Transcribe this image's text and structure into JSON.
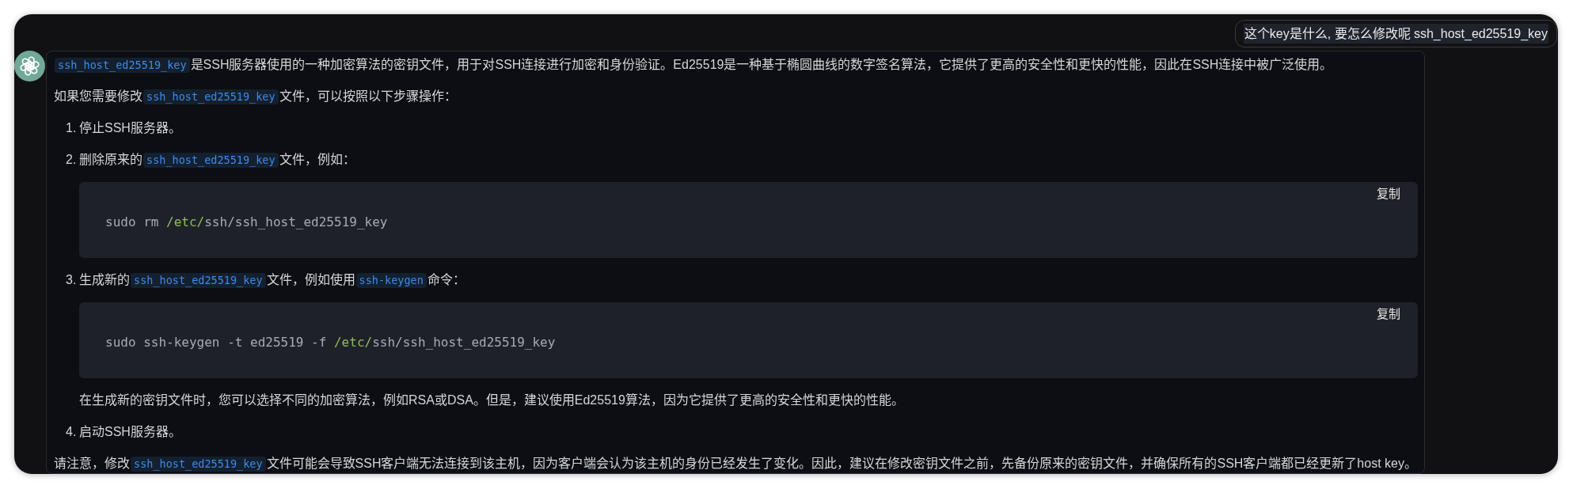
{
  "user_message": {
    "text": "这个key是什么, 要怎么修改呢 ssh_host_ed25519_key"
  },
  "assistant_message": {
    "blocks": [
      {
        "kind": "paragraph",
        "parts": [
          {
            "kind": "code",
            "text": "ssh_host_ed25519_key"
          },
          {
            "kind": "text",
            "text": "是SSH服务器使用的一种加密算法的密钥文件，用于对SSH连接进行加密和身份验证。Ed25519是一种基于椭圆曲线的数字签名算法，它提供了更高的安全性和更快的性能，因此在SSH连接中被广泛使用。"
          }
        ]
      },
      {
        "kind": "paragraph",
        "parts": [
          {
            "kind": "text",
            "text": "如果您需要修改"
          },
          {
            "kind": "code",
            "text": "ssh_host_ed25519_key"
          },
          {
            "kind": "text",
            "text": "文件，可以按照以下步骤操作："
          }
        ]
      },
      {
        "kind": "list_item",
        "number": "1.",
        "parts": [
          {
            "kind": "text",
            "text": "停止SSH服务器。"
          }
        ]
      },
      {
        "kind": "list_item",
        "number": "2.",
        "parts": [
          {
            "kind": "text",
            "text": "删除原来的"
          },
          {
            "kind": "code",
            "text": "ssh_host_ed25519_key"
          },
          {
            "kind": "text",
            "text": "文件，例如："
          }
        ],
        "children": [
          {
            "kind": "code_block",
            "copy_label": "复制",
            "tokens": [
              {
                "kind": "plain",
                "text": "sudo rm "
              },
              {
                "kind": "path",
                "text": "/etc/"
              },
              {
                "kind": "plain",
                "text": "ssh/ssh_host_ed25519_key"
              }
            ]
          }
        ]
      },
      {
        "kind": "list_item",
        "number": "3.",
        "parts": [
          {
            "kind": "text",
            "text": "生成新的"
          },
          {
            "kind": "code",
            "text": "ssh_host_ed25519_key"
          },
          {
            "kind": "text",
            "text": "文件，例如使用"
          },
          {
            "kind": "code",
            "text": "ssh-keygen"
          },
          {
            "kind": "text",
            "text": "命令："
          }
        ],
        "children": [
          {
            "kind": "code_block",
            "copy_label": "复制",
            "tokens": [
              {
                "kind": "plain",
                "text": "sudo ssh-keygen -t ed25519 -f "
              },
              {
                "kind": "path",
                "text": "/etc/"
              },
              {
                "kind": "plain",
                "text": "ssh/ssh_host_ed25519_key"
              }
            ]
          },
          {
            "kind": "paragraph",
            "parts": [
              {
                "kind": "text",
                "text": "在生成新的密钥文件时，您可以选择不同的加密算法，例如RSA或DSA。但是，建议使用Ed25519算法，因为它提供了更高的安全性和更快的性能。"
              }
            ]
          }
        ]
      },
      {
        "kind": "list_item",
        "number": "4.",
        "parts": [
          {
            "kind": "text",
            "text": "启动SSH服务器。"
          }
        ]
      },
      {
        "kind": "paragraph",
        "parts": [
          {
            "kind": "text",
            "text": "请注意，修改"
          },
          {
            "kind": "code",
            "text": "ssh_host_ed25519_key"
          },
          {
            "kind": "text",
            "text": "文件可能会导致SSH客户端无法连接到该主机，因为客户端会认为该主机的身份已经发生了变化。因此，建议在修改密钥文件之前，先备份原来的密钥文件，并确保所有的SSH客户端都已经更新了host key。"
          }
        ]
      }
    ]
  }
}
